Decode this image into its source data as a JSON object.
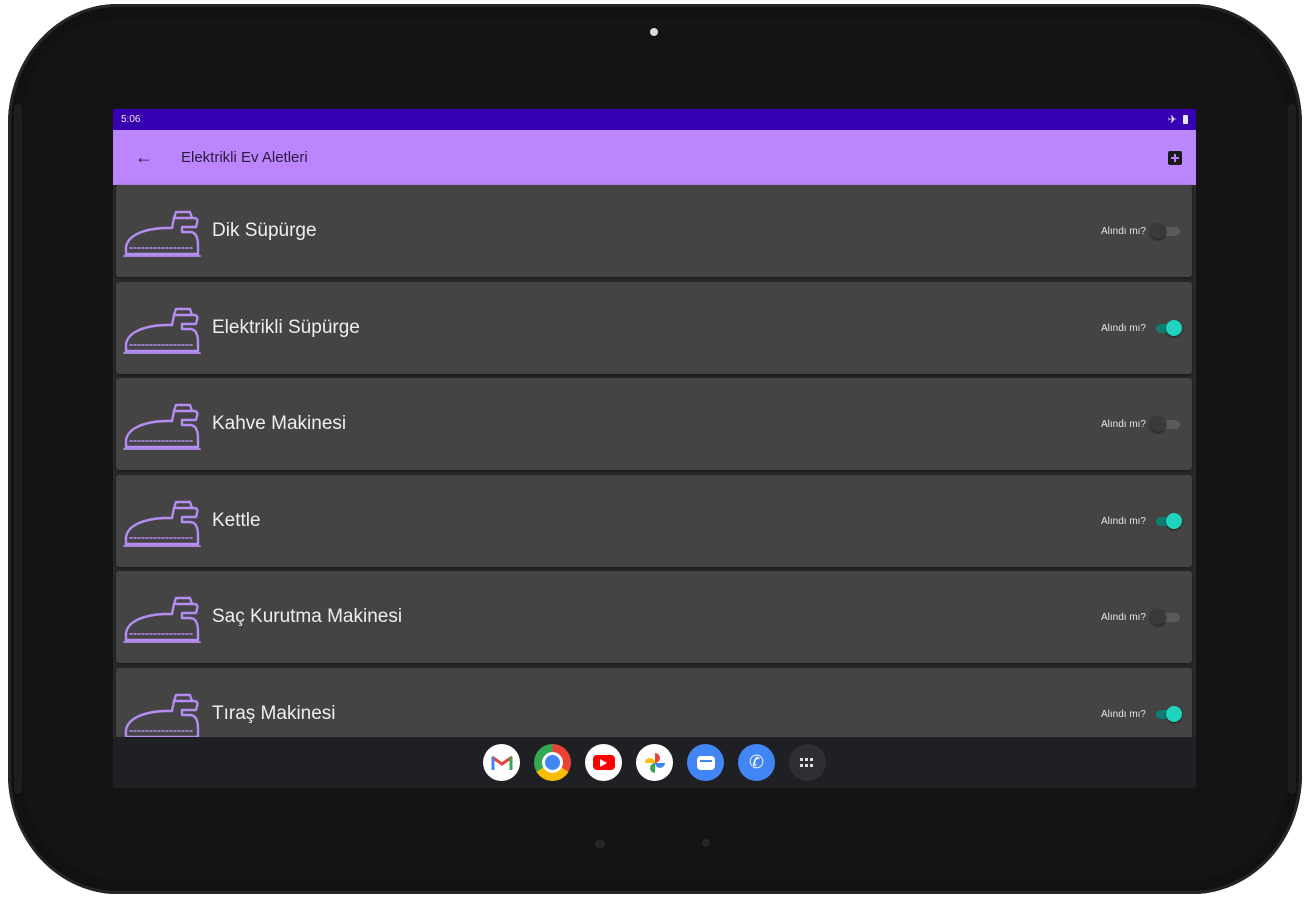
{
  "status_bar": {
    "time": "5:06"
  },
  "app_bar": {
    "title": "Elektrikli Ev Aletleri",
    "back_icon": "arrow-left-icon",
    "add_icon": "add-box-icon"
  },
  "items": [
    {
      "name": "Dik Süpürge",
      "toggle_label": "Alındı mı?",
      "checked": false
    },
    {
      "name": "Elektrikli Süpürge",
      "toggle_label": "Alındı mı?",
      "checked": true
    },
    {
      "name": "Kahve Makinesi",
      "toggle_label": "Alındı mı?",
      "checked": false
    },
    {
      "name": "Kettle",
      "toggle_label": "Alındı mı?",
      "checked": true
    },
    {
      "name": "Saç Kurutma Makinesi",
      "toggle_label": "Alındı mı?",
      "checked": false
    },
    {
      "name": "Tıraş Makinesi",
      "toggle_label": "Alındı mı?",
      "checked": true
    }
  ],
  "dock": {
    "apps": [
      "gmail-icon",
      "chrome-icon",
      "youtube-icon",
      "photos-icon",
      "messages-icon",
      "phone-icon",
      "app-drawer-icon"
    ]
  },
  "colors": {
    "status_bar": "#3700b3",
    "app_bar": "#bb86fc",
    "card": "#444444",
    "icon_purple": "#b58cf0",
    "switch_on": "#1fd3bd"
  }
}
